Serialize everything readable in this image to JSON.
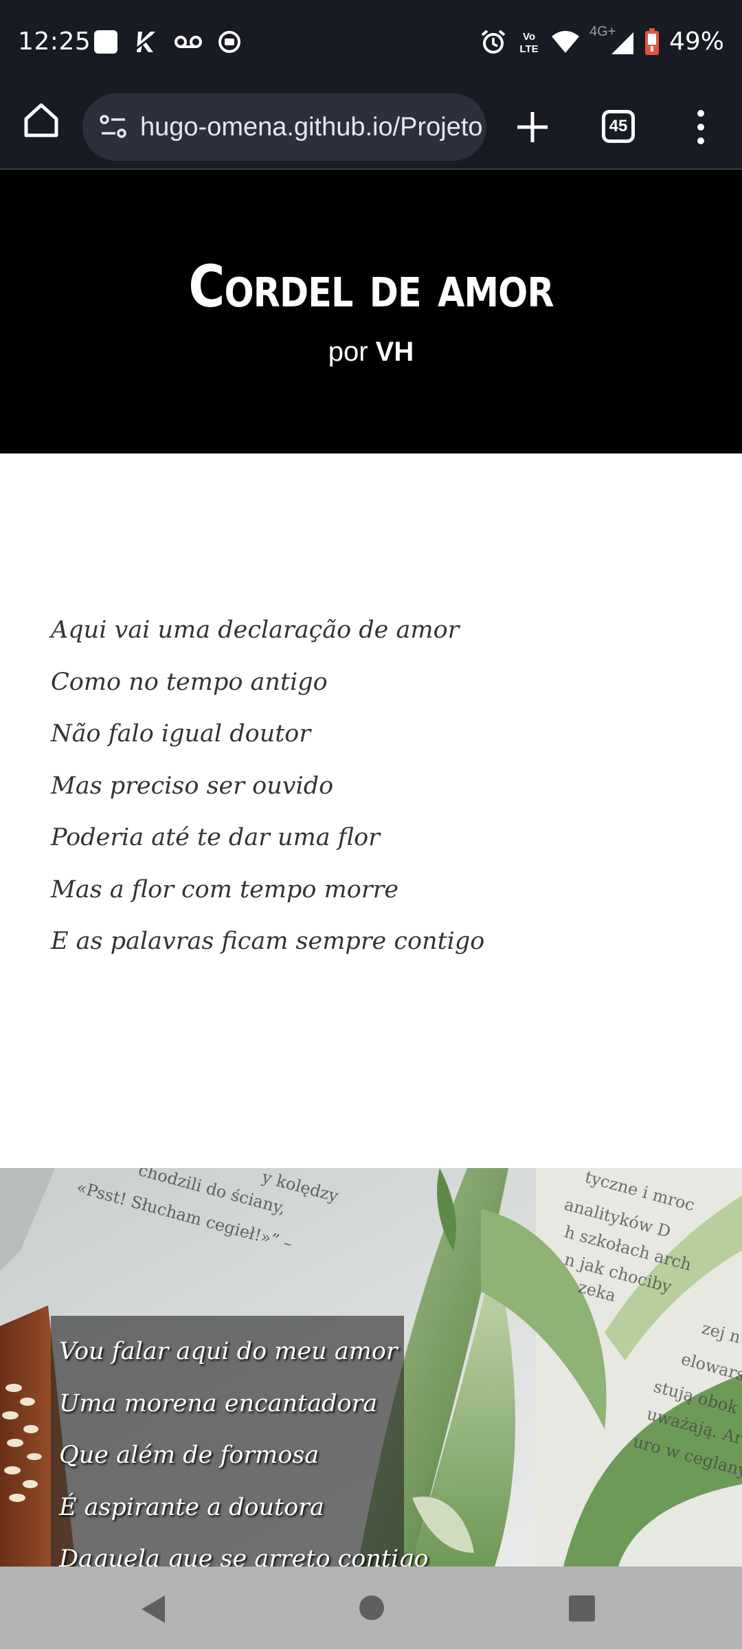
{
  "status_bar": {
    "time": "12:25",
    "battery": "49%",
    "network": "4G+",
    "volte": "Vo LTE",
    "icons": [
      "app-icon",
      "k-icon",
      "voicemail-icon",
      "media-icon",
      "alarm-icon",
      "volte-icon",
      "wifi-icon",
      "signal-icon",
      "battery-icon"
    ]
  },
  "browser": {
    "url": "hugo-omena.github.io/Projeto",
    "tab_count": "45",
    "icons": [
      "home-icon",
      "site-settings-icon",
      "new-tab-icon",
      "tabs-icon",
      "menu-icon"
    ]
  },
  "header": {
    "title": "Cordel de amor",
    "by_prefix": "por",
    "author": "VH"
  },
  "poem_section_1": {
    "verses": [
      "Aqui vai uma declaração de amor",
      "Como no tempo antigo",
      "Não falo igual doutor",
      "Mas preciso ser ouvido",
      "Poderia até te dar uma flor",
      "Mas a flor com tempo morre",
      "E as palavras ficam sempre contigo"
    ]
  },
  "poem_section_2": {
    "verses": [
      "Vou falar aqui do meu amor",
      "Uma morena encantadora",
      "Que além de formosa",
      "É aspirante a doutora",
      "Daquela que se arreto contigo"
    ],
    "background_text_left_1": "«Psst! Słucham cegieł!»” –",
    "background_text_left_2": "chodzili do ściany,",
    "background_text_left_3": "y kolędzy",
    "background_text_right": [
      "tyczne i mroc",
      "analityków D",
      "h szkołach arch",
      "n jak chociby",
      "zeka",
      "zej n",
      "elowarstw",
      "stują obok sie",
      "uważają. Archite",
      "uro w ceglanym"
    ]
  },
  "colors": {
    "status_bg": "#181a24",
    "url_pill": "#2c2f3c",
    "hero_bg": "#000000",
    "verse_color": "#333333",
    "navbar_bg": "#b3b3b3"
  }
}
